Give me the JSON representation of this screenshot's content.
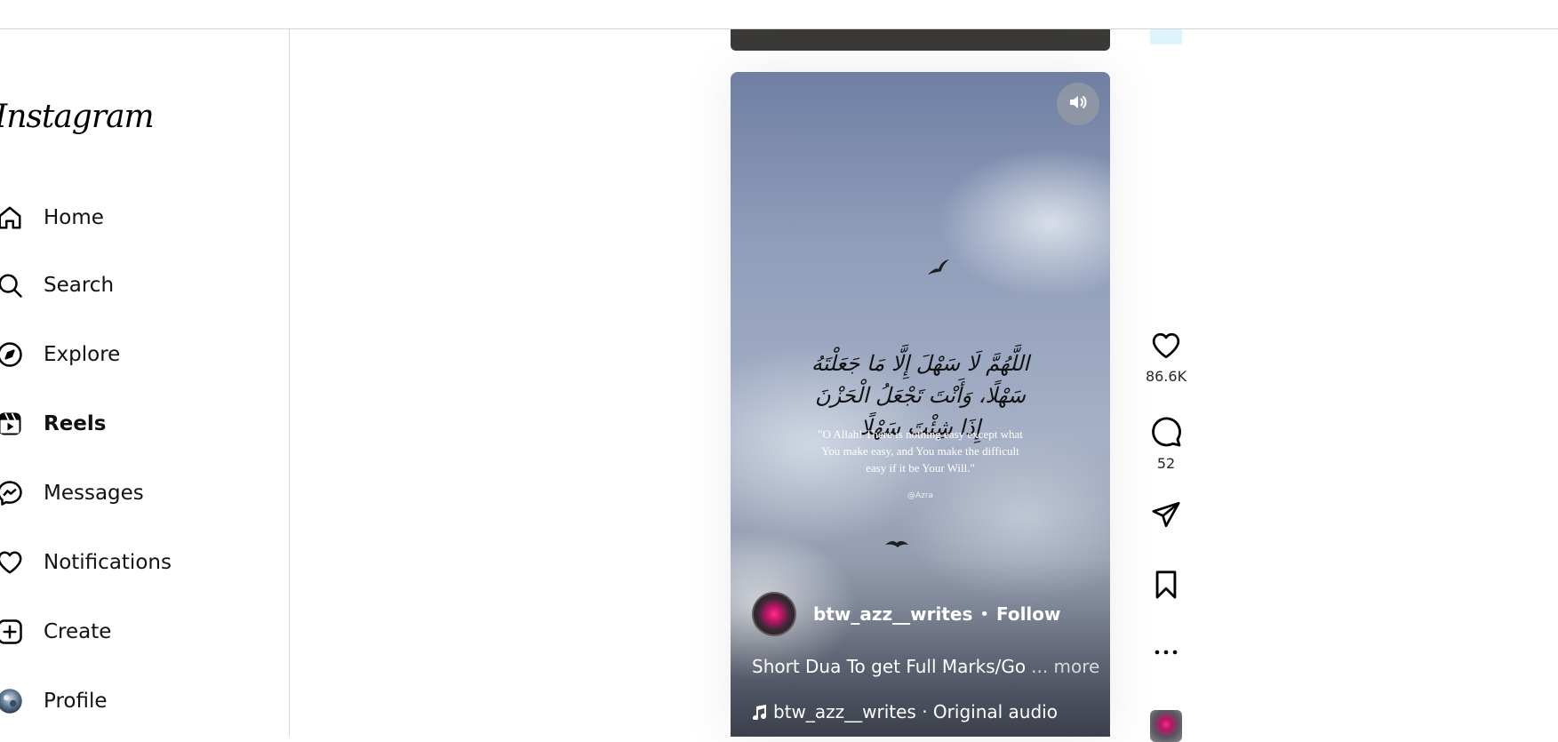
{
  "sidebar": {
    "logo": "Instagram",
    "items": [
      {
        "label": "Home",
        "icon": "home-icon"
      },
      {
        "label": "Search",
        "icon": "search-icon"
      },
      {
        "label": "Explore",
        "icon": "compass-icon"
      },
      {
        "label": "Reels",
        "icon": "reels-icon",
        "active": true
      },
      {
        "label": "Messages",
        "icon": "messenger-icon"
      },
      {
        "label": "Notifications",
        "icon": "heart-icon"
      },
      {
        "label": "Create",
        "icon": "plus-square-icon"
      },
      {
        "label": "Profile",
        "icon": "avatar"
      }
    ]
  },
  "reel": {
    "overlay_arabic": "اللَّهُمَّ لَا سَهْلَ إِلَّا مَا جَعَلْتَهُ سَهْلًا، وَأَنْتَ تَجْعَلُ الْحَزْنَ إِذَا شِئْتَ سَهْلًا",
    "overlay_translation": "\"O Allah! There is nothing easy except what You make easy, and You make the difficult easy if it be Your Will.\"",
    "watermark": "@Azra",
    "author": "btw_azz__writes",
    "separator": "•",
    "follow_label": "Follow",
    "caption": "Short Dua To get Full Marks/Go",
    "more_label": "... more",
    "audio": "btw_azz__writes · Original audio"
  },
  "actions": {
    "likes": "86.6K",
    "comments": "52"
  },
  "colors": {
    "text": "#000000",
    "border": "#dbdbdb",
    "overlay_text": "#ffffff"
  }
}
